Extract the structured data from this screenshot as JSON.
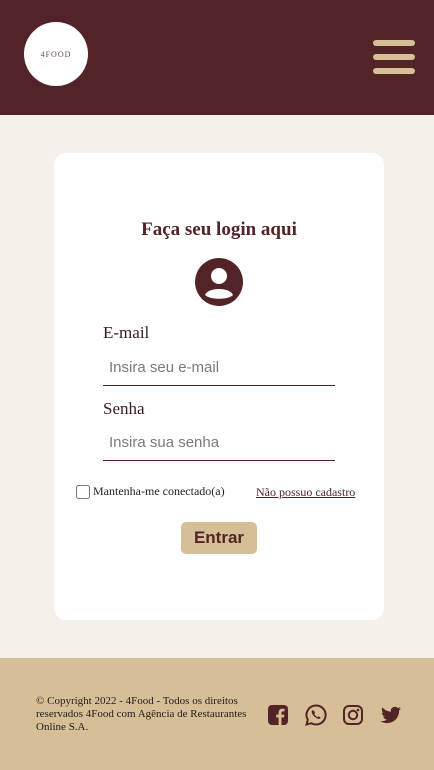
{
  "header": {
    "logo_text": "4FOOD",
    "menu_icon": "hamburger-menu-icon"
  },
  "login": {
    "title": "Faça seu login aqui",
    "user_icon": "user-avatar-icon",
    "email_label": "E-mail",
    "email_placeholder": "Insira seu e-mail",
    "email_value": "",
    "password_label": "Senha",
    "password_placeholder": "Insira sua senha",
    "password_value": "",
    "remember_label": "Mantenha-me conectado(a)",
    "remember_checked": false,
    "no_account_link": "Não possuo cadastro",
    "submit_label": "Entrar"
  },
  "footer": {
    "copyright": "© Copyright 2022 - 4Food - Todos os direitos reservados 4Food com Agência de Restaurantes Online S.A.",
    "social_icons": [
      "facebook-icon",
      "whatsapp-icon",
      "instagram-icon",
      "twitter-icon"
    ]
  },
  "colors": {
    "brand_dark": "#532427",
    "brand_light": "#d6bf96",
    "background": "#f5f0ea",
    "card": "#ffffff"
  }
}
